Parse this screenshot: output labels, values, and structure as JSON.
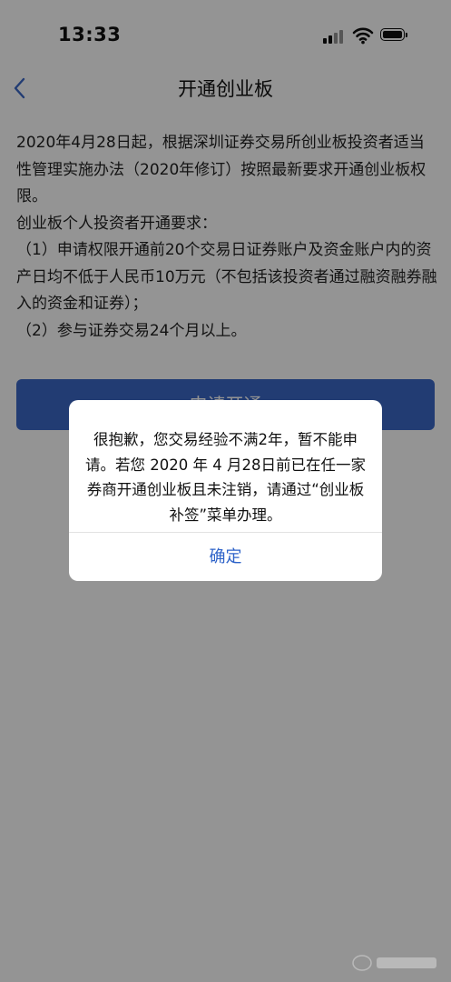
{
  "status_bar": {
    "time": "13:33"
  },
  "nav": {
    "title": "开通创业板"
  },
  "content": {
    "intro": "2020年4月28日起，根据深圳证券交易所创业板投资者适当性管理实施办法（2020年修订）按照最新要求开通创业板权限。",
    "requirements_heading": "创业板个人投资者开通要求：",
    "requirement_1": "（1）申请权限开通前20个交易日证券账户及资金账户内的资产日均不低于人民币10万元（不包括该投资者通过融资融券融入的资金和证券）；",
    "requirement_2": "（2）参与证券交易24个月以上。",
    "apply_button": "申请开通"
  },
  "dialog": {
    "message": "很抱歉，您交易经验不满2年，暂不能申请。若您 2020 年 4 月28日前已在任一家券商开通创业板且未注销，请通过“创业板补签”菜单办理。",
    "confirm_button": "确定"
  }
}
